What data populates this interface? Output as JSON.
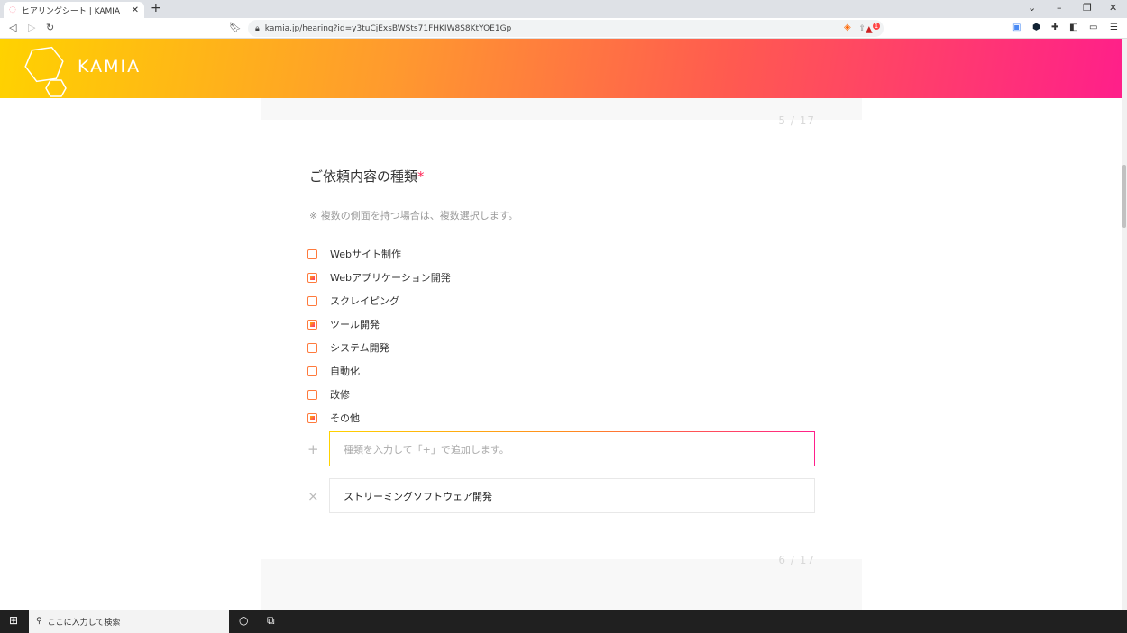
{
  "browser": {
    "tab_title": "ヒアリングシート | KAMIA",
    "url": "kamia.jp/hearing?id=y3tuCjExsBWSts71FHKIW8S8KtYOE1Gp",
    "badge_count": "1"
  },
  "header": {
    "brand": "KAMIA"
  },
  "question": {
    "page_prev": "5 / 17",
    "page_next": "6 / 17",
    "title": "ご依頼内容の種類",
    "required_mark": "*",
    "note": "※ 複数の側面を持つ場合は、複数選択します。",
    "options": [
      {
        "label": "Webサイト制作",
        "checked": false
      },
      {
        "label": "Webアプリケーション開発",
        "checked": true
      },
      {
        "label": "スクレイピング",
        "checked": false
      },
      {
        "label": "ツール開発",
        "checked": true
      },
      {
        "label": "システム開発",
        "checked": false
      },
      {
        "label": "自動化",
        "checked": false
      },
      {
        "label": "改修",
        "checked": false
      },
      {
        "label": "その他",
        "checked": true
      }
    ],
    "add_placeholder": "種類を入力して「+」で追加します。",
    "added_items": [
      "ストリーミングソフトウェア開発"
    ]
  },
  "taskbar": {
    "search_placeholder": "ここに入力して検索"
  },
  "colors": {
    "gradient_start": "#ffd200",
    "gradient_end": "#ff1f8a",
    "required": "#ff2b5a"
  }
}
